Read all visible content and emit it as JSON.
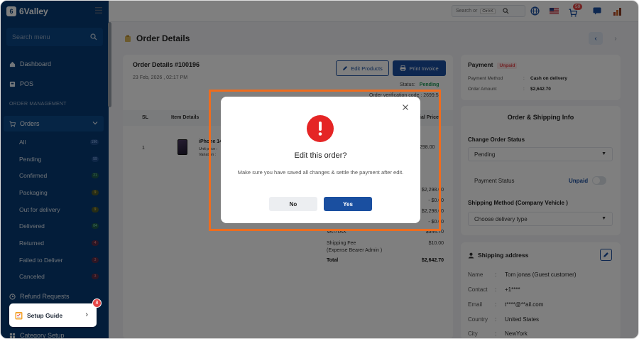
{
  "brand": {
    "name": "6Valley",
    "logo_letter": "6"
  },
  "sidebar": {
    "search_placeholder": "Search menu",
    "dashboard": "Dashboard",
    "pos": "POS",
    "section_order_management": "ORDER MANAGEMENT",
    "orders": "Orders",
    "sub_items": [
      {
        "label": "All",
        "count": "196"
      },
      {
        "label": "Pending",
        "count": "59"
      },
      {
        "label": "Confirmed",
        "count": "21"
      },
      {
        "label": "Packaging",
        "count": "9"
      },
      {
        "label": "Out for delivery",
        "count": "9"
      },
      {
        "label": "Delivered",
        "count": "84"
      },
      {
        "label": "Returned",
        "count": "4"
      },
      {
        "label": "Failed to Deliver",
        "count": "3"
      },
      {
        "label": "Canceled",
        "count": "3"
      }
    ],
    "refund_requests": "Refund Requests",
    "category_setup": "Category Setup",
    "setup_guide": "Setup Guide",
    "setup_guide_badge": "8"
  },
  "topbar": {
    "search_placeholder": "Search or",
    "kbd": "Ctrl+K",
    "cart_count": "59"
  },
  "page": {
    "title": "Order Details"
  },
  "order": {
    "heading": "Order Details #100196",
    "date": "23 Feb, 2026 , 02:17 PM",
    "edit_products": "Edit Products",
    "print_invoice": "Print Invoice",
    "status_label": "Status:",
    "status_value": "Pending",
    "verification_code": "Order verification code : 2699:5",
    "table_headers": {
      "sl": "SL",
      "item_details": "Item Details",
      "price": "ial Price"
    },
    "row": {
      "sl": "1",
      "name": "iPhone 14",
      "unit_price": "Unit price :",
      "variation": "Variation :",
      "price": "298.00"
    },
    "summary": [
      {
        "label": "",
        "value": "$2,298.00"
      },
      {
        "label": "",
        "value": "- $0.00"
      },
      {
        "label": "",
        "value": "$2,298.00"
      },
      {
        "label": "",
        "value": "- $0.00"
      },
      {
        "label": "VAT/TAX",
        "value": "$344.70"
      },
      {
        "label": "Shipping Fee",
        "value": "$10.00"
      },
      {
        "label": "(Expense Bearer Admin )",
        "value": ""
      },
      {
        "label": "Total",
        "value": "$2,642.70"
      }
    ]
  },
  "payment": {
    "title": "Payment",
    "status": "Unpaid",
    "method_label": "Payment Method",
    "method_value": "Cash on delivery",
    "amount_label": "Order Amount",
    "amount_value": "$2,642.70"
  },
  "shipping_info": {
    "title": "Order & Shipping Info",
    "change_status_label": "Change Order Status",
    "change_status_value": "Pending",
    "payment_status_label": "Payment Status",
    "payment_status_value": "Unpaid",
    "shipping_method_label": "Shipping Method (Company Vehicle )",
    "shipping_method_value": "Choose delivery type"
  },
  "address": {
    "title": "Shipping address",
    "rows": [
      {
        "label": "Name",
        "value": "Tom jonas (Guest customer)"
      },
      {
        "label": "Contact",
        "value": "+1****"
      },
      {
        "label": "Email",
        "value": "t****@**ail.com"
      },
      {
        "label": "Country",
        "value": "United States"
      },
      {
        "label": "City",
        "value": "NewYork"
      }
    ]
  },
  "modal": {
    "title": "Edit this order?",
    "message": "Make sure you have saved all changes & settle the payment after edit.",
    "no_label": "No",
    "yes_label": "Yes"
  },
  "colors": {
    "sidebar": "#073b74",
    "primary": "#1a4fa0",
    "danger": "#e52525",
    "highlight": "#ee6c1e"
  }
}
